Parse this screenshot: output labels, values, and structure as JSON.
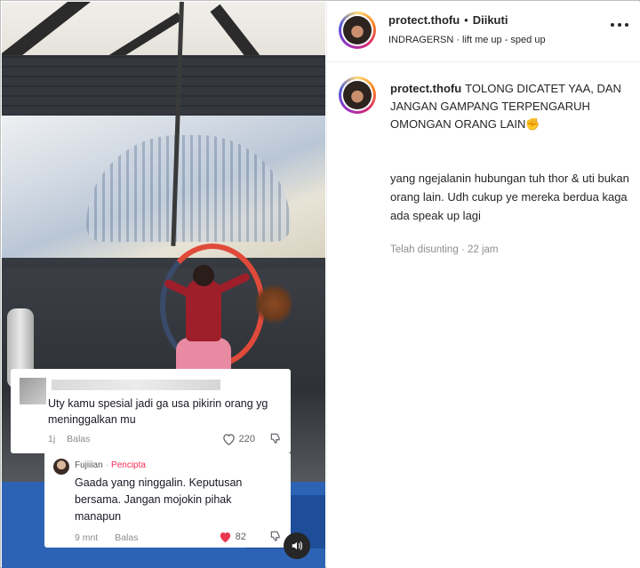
{
  "post": {
    "username": "protect.thofu",
    "dot": "•",
    "follow_status": "Diikuti",
    "audio_artist": "INDRAGERSN",
    "audio_sep": "·",
    "audio_track": "lift me up - sped up"
  },
  "caption": {
    "username": "protect.thofu",
    "text": "TOLONG DICATET YAA, DAN JANGAN GAMPANG TERPENGARUH OMONGAN ORANG LAIN✊",
    "paragraph2": "yang ngejalanin hubungan tuh thor & uti bukan orang lain. Udh cukup ye mereka berdua kaga ada speak up lagi",
    "edited_label": "Telah disunting",
    "meta_sep": "·",
    "time": "22 jam"
  },
  "overlay": {
    "comment": {
      "text": "Uty kamu spesial jadi ga usa pikirin orang yg meninggalkan mu",
      "time": "1j",
      "reply_label": "Balas",
      "likes": "220"
    },
    "reply": {
      "author": "Fujiiian",
      "sep": "·",
      "author_tag": "Pencipta",
      "text": "Gaada yang ninggalin. Keputusan bersama. Jangan mojokin pihak manapun",
      "time": "9 mnt",
      "reply_label": "Balas",
      "likes": "82"
    }
  },
  "colors": {
    "creator_tag": "#fe2c55",
    "liked_heart": "#e8384f",
    "story_ring": "#d62976"
  }
}
